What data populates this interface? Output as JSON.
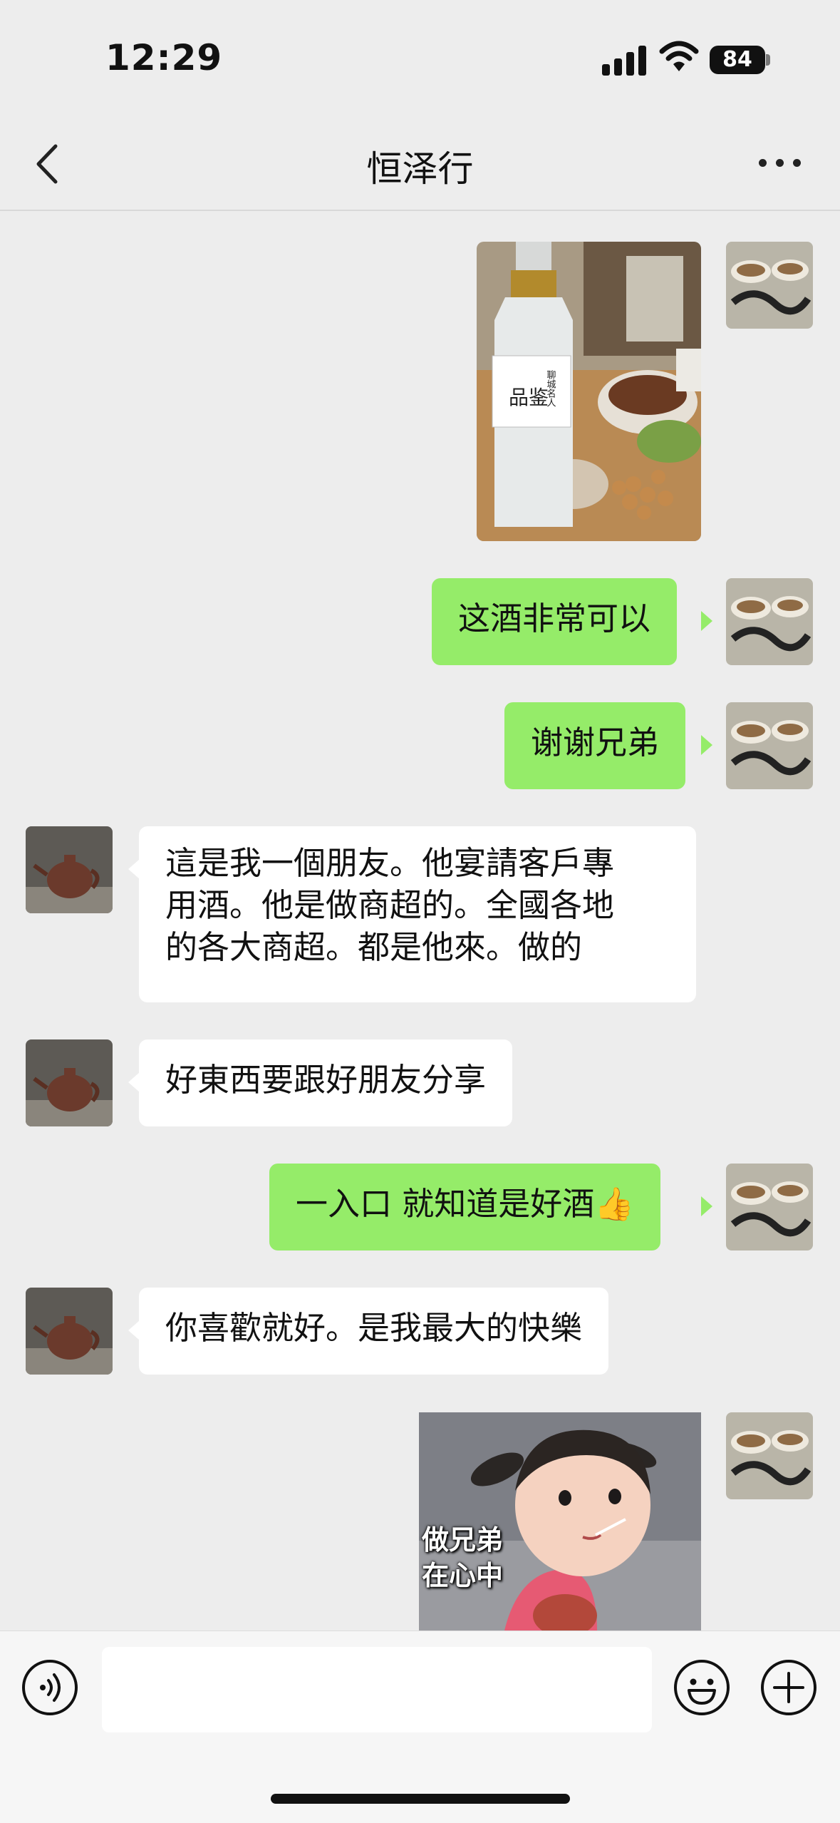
{
  "status_bar": {
    "time": "12:29",
    "battery": "84"
  },
  "header": {
    "title": "恒泽行",
    "back_icon": "chevron-left-icon",
    "more_icon": "more-dots-icon"
  },
  "messages": [
    {
      "direction": "out",
      "type": "image",
      "content": "liquor-bottle-photo"
    },
    {
      "direction": "out",
      "type": "text",
      "text": "这酒非常可以"
    },
    {
      "direction": "out",
      "type": "text",
      "text": "谢谢兄弟"
    },
    {
      "direction": "in",
      "type": "text",
      "lines": [
        "這是我一個朋友。他宴請客戶專",
        "用酒。他是做商超的。全國各地",
        "的各大商超。都是他來。做的"
      ]
    },
    {
      "direction": "in",
      "type": "text",
      "text": "好東西要跟好朋友分享"
    },
    {
      "direction": "out",
      "type": "text",
      "text": "一入口 就知道是好酒👍"
    },
    {
      "direction": "in",
      "type": "text",
      "text": "你喜歡就好。是我最大的快樂"
    },
    {
      "direction": "out",
      "type": "sticker",
      "caption_lines": [
        "做兄弟",
        "在心中"
      ]
    }
  ],
  "product_label": {
    "main": "品鉴",
    "side": "聊城名人"
  },
  "input_bar": {
    "placeholder": "",
    "voice_icon": "voice-icon",
    "emoji_icon": "emoji-icon",
    "plus_icon": "plus-icon"
  },
  "colors": {
    "outgoing_bubble": "#95ec69",
    "incoming_bubble": "#ffffff",
    "background": "#ededed"
  }
}
